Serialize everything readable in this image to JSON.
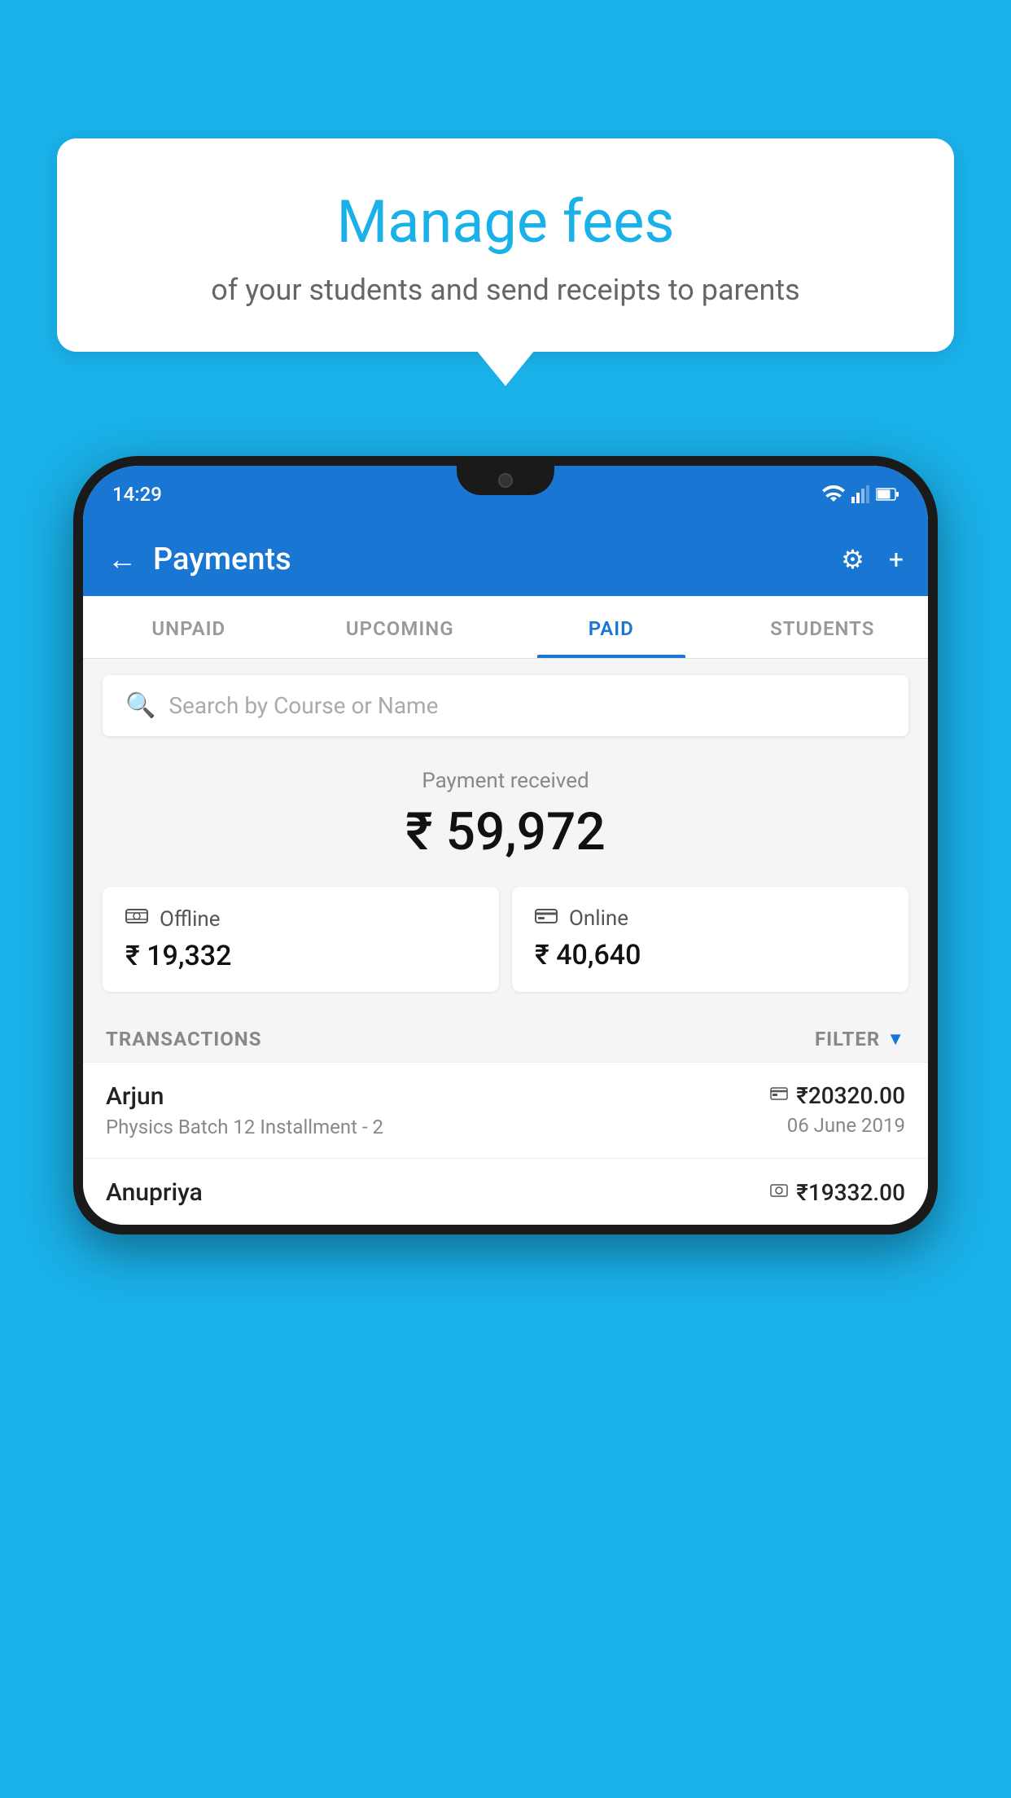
{
  "page": {
    "background_color": "#1ab0e8"
  },
  "speech_bubble": {
    "title": "Manage fees",
    "subtitle": "of your students and send receipts to parents"
  },
  "status_bar": {
    "time": "14:29"
  },
  "app_header": {
    "title": "Payments",
    "back_icon": "←",
    "settings_icon": "⚙",
    "add_icon": "+"
  },
  "tabs": [
    {
      "label": "UNPAID",
      "active": false
    },
    {
      "label": "UPCOMING",
      "active": false
    },
    {
      "label": "PAID",
      "active": true
    },
    {
      "label": "STUDENTS",
      "active": false
    }
  ],
  "search": {
    "placeholder": "Search by Course or Name"
  },
  "payment_received": {
    "label": "Payment received",
    "amount": "₹ 59,972"
  },
  "payment_cards": [
    {
      "type": "Offline",
      "amount": "₹ 19,332",
      "icon": "💵"
    },
    {
      "type": "Online",
      "amount": "₹ 40,640",
      "icon": "💳"
    }
  ],
  "transactions_section": {
    "label": "TRANSACTIONS",
    "filter_label": "FILTER"
  },
  "transactions": [
    {
      "name": "Arjun",
      "sub": "Physics Batch 12 Installment - 2",
      "amount": "₹20320.00",
      "date": "06 June 2019",
      "icon": "💳"
    },
    {
      "name": "Anupriya",
      "sub": "",
      "amount": "₹19332.00",
      "date": "",
      "icon": "💵"
    }
  ]
}
